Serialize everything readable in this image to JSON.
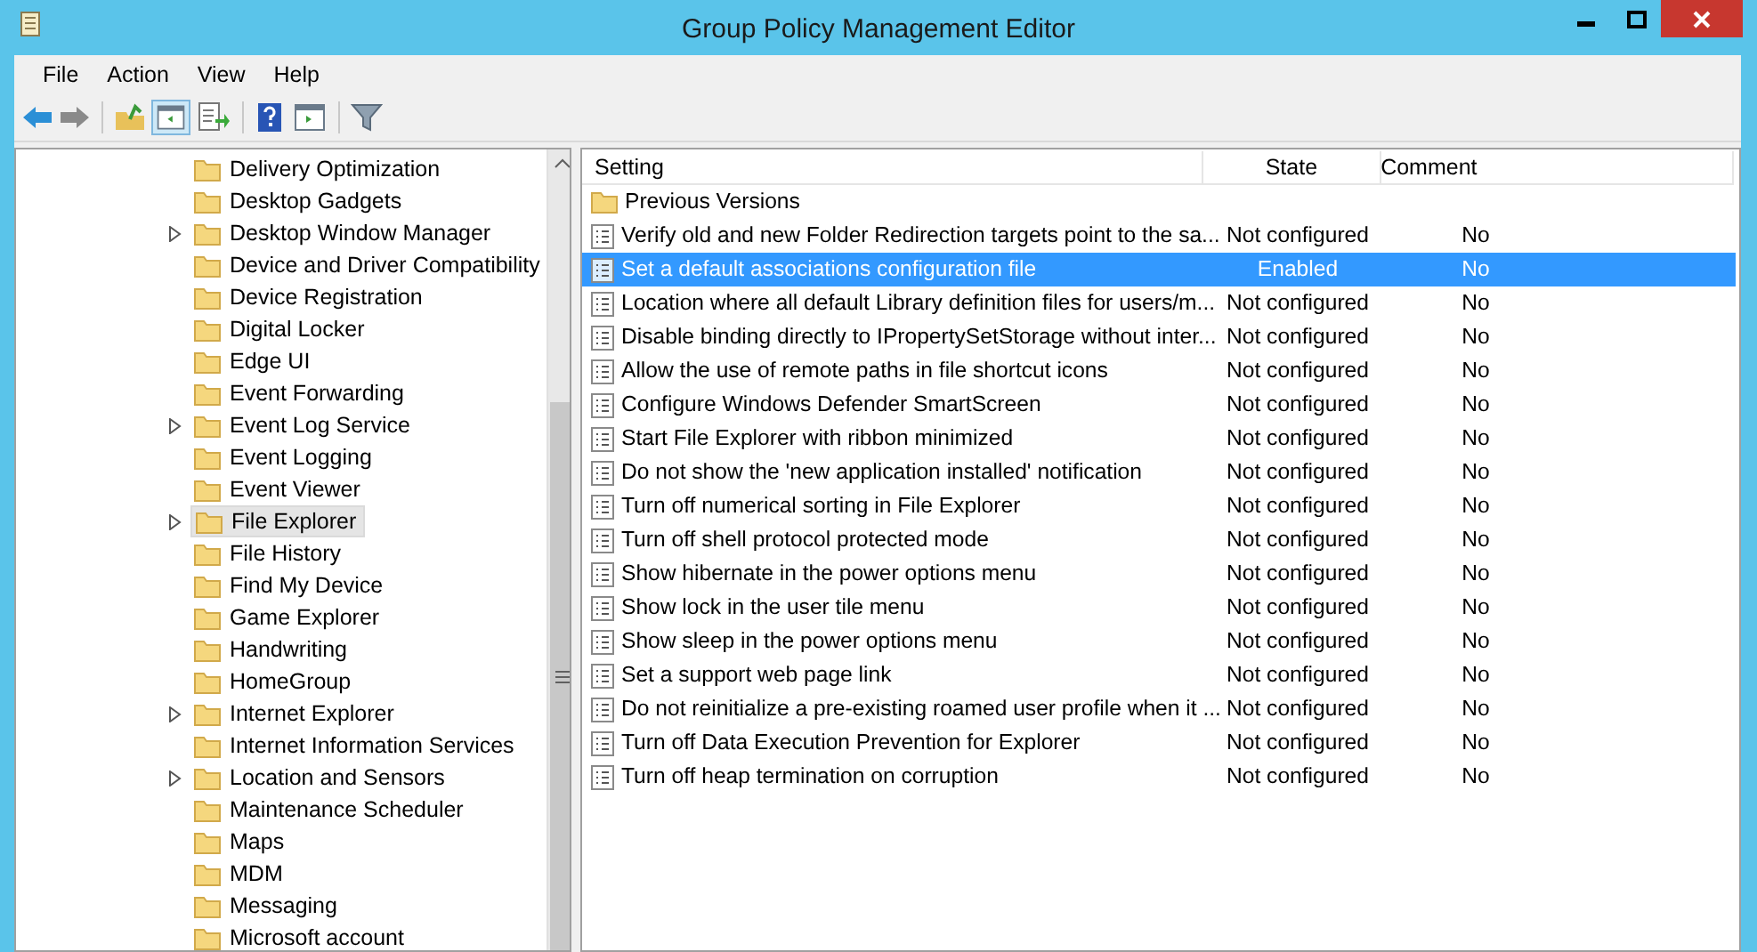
{
  "window": {
    "title": "Group Policy Management Editor"
  },
  "menu": [
    "File",
    "Action",
    "View",
    "Help"
  ],
  "tree": {
    "items": [
      {
        "label": "Delivery Optimization",
        "expandable": false,
        "selected": false
      },
      {
        "label": "Desktop Gadgets",
        "expandable": false,
        "selected": false
      },
      {
        "label": "Desktop Window Manager",
        "expandable": true,
        "selected": false
      },
      {
        "label": "Device and Driver Compatibility",
        "expandable": false,
        "selected": false
      },
      {
        "label": "Device Registration",
        "expandable": false,
        "selected": false
      },
      {
        "label": "Digital Locker",
        "expandable": false,
        "selected": false
      },
      {
        "label": "Edge UI",
        "expandable": false,
        "selected": false
      },
      {
        "label": "Event Forwarding",
        "expandable": false,
        "selected": false
      },
      {
        "label": "Event Log Service",
        "expandable": true,
        "selected": false
      },
      {
        "label": "Event Logging",
        "expandable": false,
        "selected": false
      },
      {
        "label": "Event Viewer",
        "expandable": false,
        "selected": false
      },
      {
        "label": "File Explorer",
        "expandable": true,
        "selected": true
      },
      {
        "label": "File History",
        "expandable": false,
        "selected": false
      },
      {
        "label": "Find My Device",
        "expandable": false,
        "selected": false
      },
      {
        "label": "Game Explorer",
        "expandable": false,
        "selected": false
      },
      {
        "label": "Handwriting",
        "expandable": false,
        "selected": false
      },
      {
        "label": "HomeGroup",
        "expandable": false,
        "selected": false
      },
      {
        "label": "Internet Explorer",
        "expandable": true,
        "selected": false
      },
      {
        "label": "Internet Information Services",
        "expandable": false,
        "selected": false
      },
      {
        "label": "Location and Sensors",
        "expandable": true,
        "selected": false
      },
      {
        "label": "Maintenance Scheduler",
        "expandable": false,
        "selected": false
      },
      {
        "label": "Maps",
        "expandable": false,
        "selected": false
      },
      {
        "label": "MDM",
        "expandable": false,
        "selected": false
      },
      {
        "label": "Messaging",
        "expandable": false,
        "selected": false
      },
      {
        "label": "Microsoft account",
        "expandable": false,
        "selected": false
      }
    ]
  },
  "table": {
    "columns": [
      "Setting",
      "State",
      "Comment"
    ],
    "rows": [
      {
        "kind": "folder",
        "selected": false,
        "setting": "Previous Versions"
      },
      {
        "kind": "policy",
        "selected": false,
        "setting": "Verify old and new Folder Redirection targets point to the sa...",
        "state": "Not configured",
        "comment": "No"
      },
      {
        "kind": "policy",
        "selected": true,
        "setting": "Set a default associations configuration file",
        "state": "Enabled",
        "comment": "No"
      },
      {
        "kind": "policy",
        "selected": false,
        "setting": "Location where all default Library definition files for users/m...",
        "state": "Not configured",
        "comment": "No"
      },
      {
        "kind": "policy",
        "selected": false,
        "setting": "Disable binding directly to IPropertySetStorage without inter...",
        "state": "Not configured",
        "comment": "No"
      },
      {
        "kind": "policy",
        "selected": false,
        "setting": "Allow the use of remote paths in file shortcut icons",
        "state": "Not configured",
        "comment": "No"
      },
      {
        "kind": "policy",
        "selected": false,
        "setting": "Configure Windows Defender SmartScreen",
        "state": "Not configured",
        "comment": "No"
      },
      {
        "kind": "policy",
        "selected": false,
        "setting": "Start File Explorer with ribbon minimized",
        "state": "Not configured",
        "comment": "No"
      },
      {
        "kind": "policy",
        "selected": false,
        "setting": "Do not show the 'new application installed' notification",
        "state": "Not configured",
        "comment": "No"
      },
      {
        "kind": "policy",
        "selected": false,
        "setting": "Turn off numerical sorting in File Explorer",
        "state": "Not configured",
        "comment": "No"
      },
      {
        "kind": "policy",
        "selected": false,
        "setting": "Turn off shell protocol protected mode",
        "state": "Not configured",
        "comment": "No"
      },
      {
        "kind": "policy",
        "selected": false,
        "setting": "Show hibernate in the power options menu",
        "state": "Not configured",
        "comment": "No"
      },
      {
        "kind": "policy",
        "selected": false,
        "setting": "Show lock in the user tile menu",
        "state": "Not configured",
        "comment": "No"
      },
      {
        "kind": "policy",
        "selected": false,
        "setting": "Show sleep in the power options menu",
        "state": "Not configured",
        "comment": "No"
      },
      {
        "kind": "policy",
        "selected": false,
        "setting": "Set a support web page link",
        "state": "Not configured",
        "comment": "No"
      },
      {
        "kind": "policy",
        "selected": false,
        "setting": "Do not reinitialize a pre-existing roamed user profile when it ...",
        "state": "Not configured",
        "comment": "No"
      },
      {
        "kind": "policy",
        "selected": false,
        "setting": "Turn off Data Execution Prevention for Explorer",
        "state": "Not configured",
        "comment": "No"
      },
      {
        "kind": "policy",
        "selected": false,
        "setting": "Turn off heap termination on corruption",
        "state": "Not configured",
        "comment": "No"
      }
    ]
  }
}
